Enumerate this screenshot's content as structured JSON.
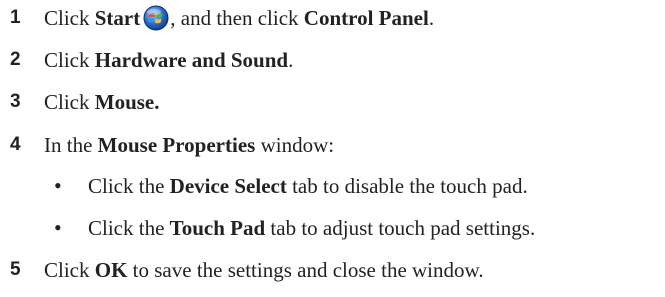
{
  "steps": [
    {
      "number": "1",
      "parts": [
        "Click ",
        "Start",
        ", and then click ",
        "Control Panel",
        "."
      ],
      "icon": "windows-start-orb-icon"
    },
    {
      "number": "2",
      "parts": [
        "Click ",
        "Hardware and Sound",
        "."
      ]
    },
    {
      "number": "3",
      "parts": [
        "Click ",
        "Mouse."
      ]
    },
    {
      "number": "4",
      "parts": [
        "In the ",
        "Mouse Properties",
        " window:"
      ]
    },
    {
      "number": "5",
      "parts": [
        "Click ",
        "OK",
        " to save the settings and close the window."
      ]
    }
  ],
  "bullets": [
    {
      "symbol": "•",
      "parts": [
        "Click the ",
        "Device Select",
        " tab to disable the touch pad."
      ]
    },
    {
      "symbol": "•",
      "parts": [
        "Click the ",
        "Touch Pad",
        " tab to adjust touch pad settings."
      ]
    }
  ],
  "colors": {
    "text": "#222222",
    "orb_blue": "#2a6fd1",
    "orb_red": "#e0412b",
    "orb_green": "#5bb53a",
    "orb_yellow": "#f2c12e"
  }
}
